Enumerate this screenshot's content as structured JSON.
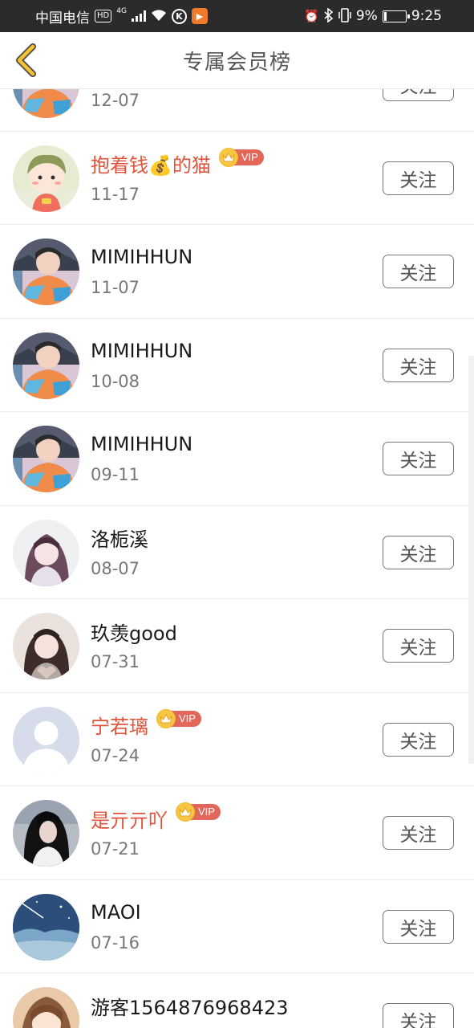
{
  "status_bar": {
    "carrier": "中国电信",
    "hd_badge": "HD",
    "network": "4G",
    "battery_percent": "9%",
    "time": "9:25",
    "icons": [
      "wifi-icon",
      "k-icon",
      "play-icon",
      "alarm-icon",
      "bluetooth-icon",
      "vibrate-icon",
      "battery-icon"
    ]
  },
  "nav": {
    "title": "专属会员榜",
    "back_icon": "chevron-left-icon"
  },
  "vip_label": "VIP",
  "follow_label": "关注",
  "colors": {
    "vip_name": "#e0543c",
    "back_arrow": "#f3c131",
    "vip_tag": "#e2665a",
    "crown": "#f7c744"
  },
  "members": [
    {
      "name": "",
      "date": "12-07",
      "vip": false,
      "avatar": "boy-photo"
    },
    {
      "name": "抱着钱💰的猫",
      "date": "11-17",
      "vip": true,
      "avatar": "cartoon-boy"
    },
    {
      "name": "MIMIHHUN",
      "date": "11-07",
      "vip": false,
      "avatar": "boy-photo"
    },
    {
      "name": "MIMIHHUN",
      "date": "10-08",
      "vip": false,
      "avatar": "boy-photo"
    },
    {
      "name": "MIMIHHUN",
      "date": "09-11",
      "vip": false,
      "avatar": "boy-photo"
    },
    {
      "name": "洛栀溪",
      "date": "08-07",
      "vip": false,
      "avatar": "girl-photo-light"
    },
    {
      "name": "玖羡good",
      "date": "07-31",
      "vip": false,
      "avatar": "girl-photo-heart"
    },
    {
      "name": "宁若璃",
      "date": "07-24",
      "vip": true,
      "avatar": "default-avatar"
    },
    {
      "name": "是亓亓吖",
      "date": "07-21",
      "vip": true,
      "avatar": "girl-photo-dark"
    },
    {
      "name": "MAOI",
      "date": "07-16",
      "vip": false,
      "avatar": "night-sky"
    },
    {
      "name": "游客1564876968423",
      "date": "",
      "vip": false,
      "avatar": "anime-girl"
    }
  ]
}
